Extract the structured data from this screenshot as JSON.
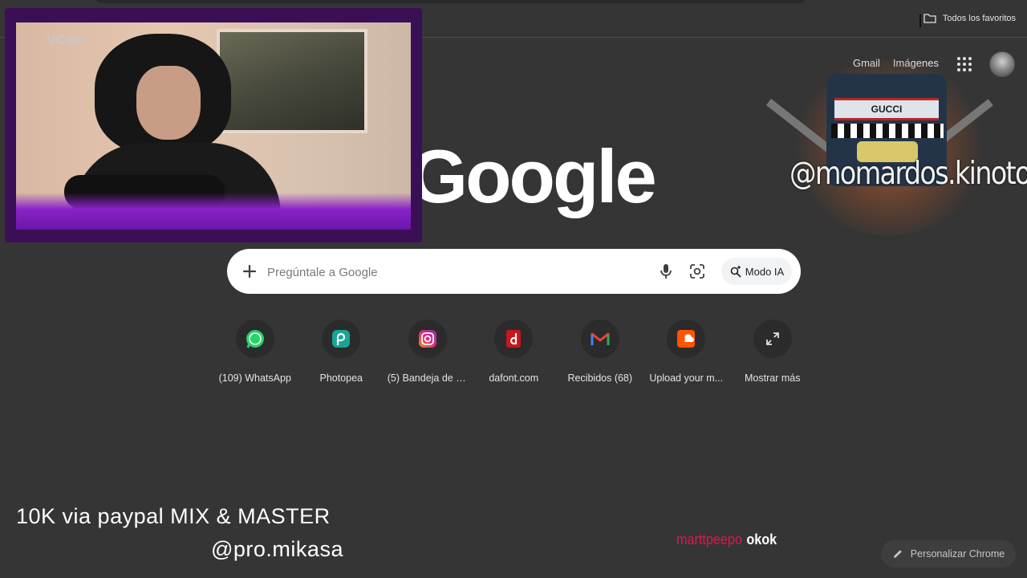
{
  "bookmarks_bar": {
    "all_bookmarks_label": "Todos los favoritos"
  },
  "header": {
    "gmail_label": "Gmail",
    "images_label": "Imágenes"
  },
  "logo": {
    "text": "Google"
  },
  "search": {
    "placeholder": "Pregúntale a Google",
    "value": "",
    "ai_mode_label": "Modo IA"
  },
  "shortcuts": [
    {
      "label": "(109) WhatsApp",
      "icon": "whatsapp-icon",
      "color": "#25D366"
    },
    {
      "label": "Photopea",
      "icon": "photopea-icon",
      "color": "#18A497"
    },
    {
      "label": "(5) Bandeja de e...",
      "icon": "instagram-icon",
      "color": "#C13584"
    },
    {
      "label": "dafont.com",
      "icon": "dafont-icon",
      "color": "#C8161D"
    },
    {
      "label": "Recibidos (68)",
      "icon": "gmail-icon",
      "color": "#EA4335"
    },
    {
      "label": "Upload your m...",
      "icon": "soundcloud-icon",
      "color": "#FF5500"
    },
    {
      "label": "Mostrar más",
      "icon": "expand-icon",
      "color": "#e3e3e3"
    }
  ],
  "overlay": {
    "webcam_label": "VCam",
    "promo_line1": "10K via paypal MIX & MASTER",
    "promo_line2": "@pro.mikasa",
    "watermark_handle": "@momardos.kinoto",
    "watermark_brand": "GUCCI",
    "chat_user": "marttpeepo",
    "chat_message": "okok"
  },
  "customize": {
    "label": "Personalizar Chrome"
  }
}
